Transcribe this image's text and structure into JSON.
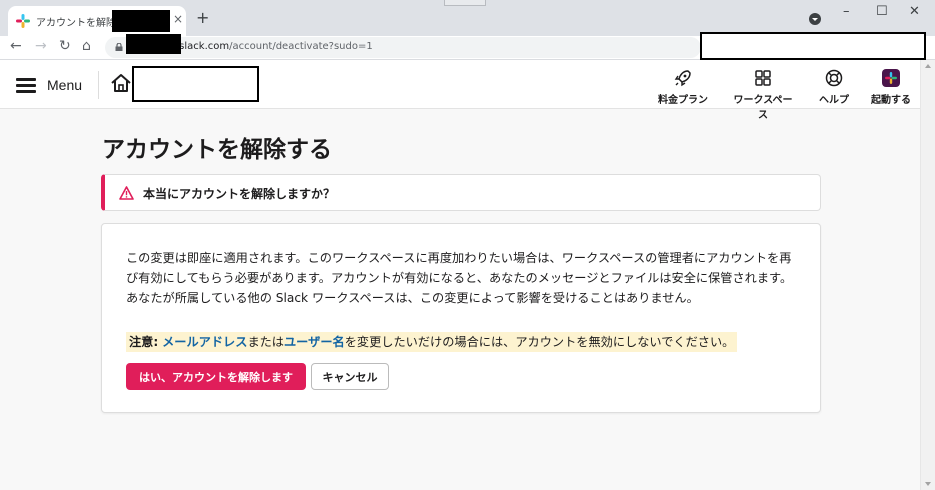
{
  "browser": {
    "tab_title": "アカウントを解除する |",
    "tab_close": "×",
    "new_tab": "+",
    "url_domain": ".slack.com",
    "url_path": "/account/deactivate?sudo=1",
    "window_minimize": "–",
    "window_maximize": "☐",
    "window_close": "✕",
    "back": "←",
    "forward": "→",
    "reload": "↻",
    "home": "⌂"
  },
  "header": {
    "menu_label": "Menu",
    "nav": [
      {
        "label": "料金プラン",
        "icon": "rocket-icon"
      },
      {
        "label": "ワークスペース",
        "icon": "grid-icon"
      },
      {
        "label": "ヘルプ",
        "icon": "lifebuoy-icon"
      },
      {
        "label": "起動する",
        "icon": "slack-logo-icon"
      }
    ]
  },
  "page": {
    "title": "アカウントを解除する",
    "warning": "本当にアカウントを解除しますか？",
    "description": "この変更は即座に適用されます。このワークスペースに再度加わりたい場合は、ワークスペースの管理者にアカウントを再び有効にしてもらう必要があります。アカウントが有効になると、あなたのメッセージとファイルは安全に保管されます。あなたが所属している他の Slack ワークスペースは、この変更によって影響を受けることはありません。",
    "note_label": "注意:",
    "note_link_email": "メールアドレス",
    "note_or": "または",
    "note_link_username": "ユーザー名",
    "note_rest": "を変更したいだけの場合には、アカウントを無効にしないでください。",
    "confirm_button": "はい、アカウントを解除します",
    "cancel_button": "キャンセル"
  },
  "colors": {
    "danger": "#e01e5a",
    "link": "#1264a3",
    "note_bg": "#fdf3d0"
  }
}
